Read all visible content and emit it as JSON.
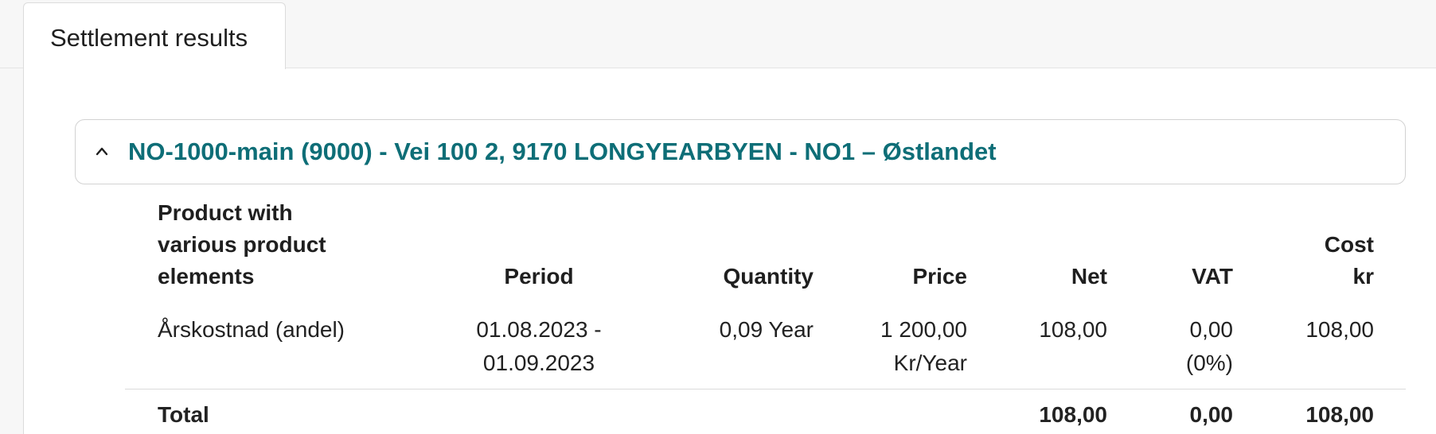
{
  "tabs": [
    {
      "label": "Settlement results",
      "active": true
    }
  ],
  "accordion": {
    "title": "NO-1000-main (9000) - Vei 100 2, 9170 LONGYEARBYEN - NO1 – Østlandet",
    "expanded": true,
    "icon": "chevron-up-icon",
    "title_color": "#0e6e77"
  },
  "table": {
    "headers": {
      "product_line1": "Product with",
      "product_line2": "various product",
      "product_line3": "elements",
      "period": "Period",
      "quantity": "Quantity",
      "price": "Price",
      "net": "Net",
      "vat": "VAT",
      "cost_line1": "Cost",
      "cost_line2": "kr"
    },
    "rows": [
      {
        "product": "Årskostnad (andel)",
        "period_line1": "01.08.2023 -",
        "period_line2": "01.09.2023",
        "quantity": "0,09 Year",
        "price_line1": "1 200,00",
        "price_line2": "Kr/Year",
        "net": "108,00",
        "vat_line1": "0,00",
        "vat_line2": "(0%)",
        "cost": "108,00"
      }
    ],
    "total": {
      "label": "Total",
      "net": "108,00",
      "vat": "0,00",
      "cost": "108,00"
    }
  }
}
